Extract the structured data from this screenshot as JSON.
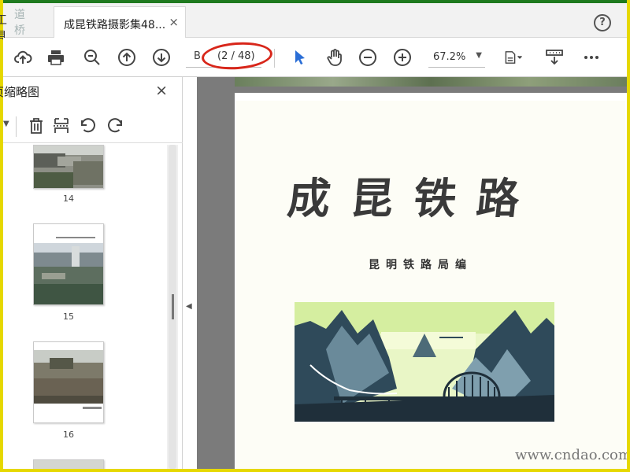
{
  "tabbar": {
    "tools_label": "工具",
    "watermark_text": "道桥网",
    "doc_tab_title": "成昆铁路摄影集48...",
    "close_glyph": "×",
    "help_glyph": "?"
  },
  "toolbar": {
    "page_current": "B",
    "page_total": "(2 / 48)",
    "zoom_value": "67.2%",
    "icons": [
      "upload-icon",
      "print-icon",
      "zoom-search-icon",
      "page-up-icon",
      "page-down-icon",
      "select-cursor-icon",
      "hand-tool-icon",
      "zoom-out-icon",
      "zoom-in-icon",
      "fit-page-icon",
      "scroll-mode-icon",
      "more-icon"
    ],
    "accent": "#2a6ed6",
    "highlight_color": "#d8261a"
  },
  "panel": {
    "title": "页缩略图",
    "close_glyph": "×",
    "thumbs": [
      {
        "label": "14"
      },
      {
        "label": "15"
      },
      {
        "label": "16"
      }
    ]
  },
  "document": {
    "title": "成昆铁路",
    "subtitle": "昆明铁路局编",
    "watermark": "www.cndao.com"
  }
}
